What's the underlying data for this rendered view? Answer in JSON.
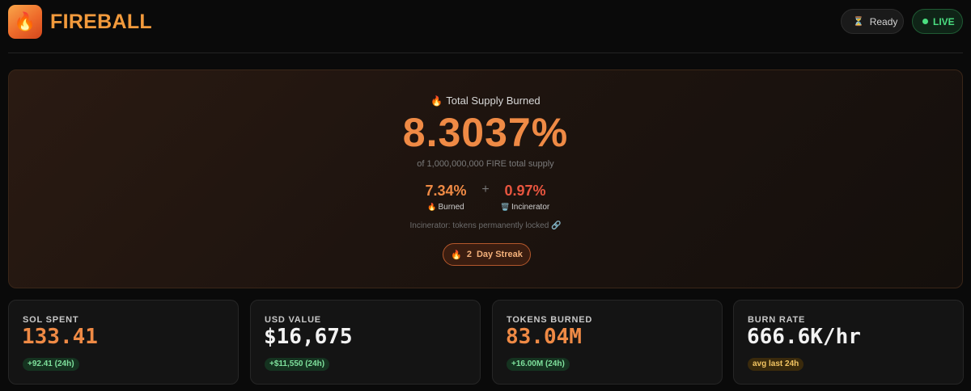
{
  "header": {
    "logo_icon": "fire-icon",
    "logo_glyph": "🔥",
    "brand": "FIREBALL",
    "status_ready": {
      "icon": "hourglass-icon",
      "glyph": "⏳",
      "label": "Ready"
    },
    "status_live": {
      "label": "LIVE",
      "color": "#4ade80"
    }
  },
  "hero": {
    "title_glyph": "🔥",
    "title": "Total Supply Burned",
    "percent": "8.3037%",
    "subtitle": "of 1,000,000,000 FIRE total supply",
    "burned": {
      "value": "7.34%",
      "glyph": "🔥",
      "label": "Burned"
    },
    "plus": "+",
    "incinerator": {
      "value": "0.97%",
      "glyph": "🗑️",
      "label": "Incinerator"
    },
    "note": "Incinerator: tokens permanently locked",
    "note_glyph": "🔗",
    "streak": {
      "glyph": "🔥",
      "count": "2",
      "label": "Day Streak"
    }
  },
  "stats": [
    {
      "label": "SOL SPENT",
      "value": "133.41",
      "badge": "+92.41 (24h)"
    },
    {
      "label": "USD VALUE",
      "value": "$16,675",
      "badge": "+$11,550 (24h)"
    },
    {
      "label": "TOKENS BURNED",
      "value": "83.04M",
      "badge": "+16.00M (24h)"
    },
    {
      "label": "BURN RATE",
      "value": "666.6K/hr",
      "badge": "avg last 24h"
    }
  ],
  "colors": {
    "accent": "#ef8a45",
    "positive": "#7ee09c",
    "warning": "#f2c462",
    "incinerator": "#e8553f"
  }
}
